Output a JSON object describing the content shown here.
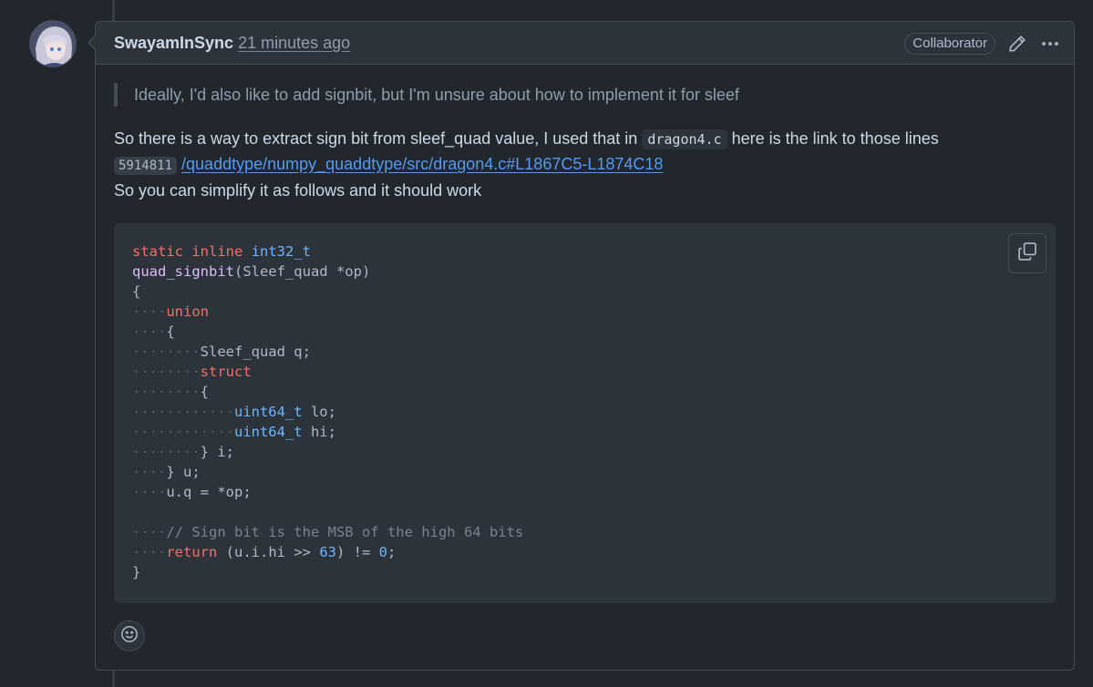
{
  "comment": {
    "author": "SwayamInSync",
    "timestamp": "21 minutes ago",
    "role_badge": "Collaborator",
    "quote": "Ideally, I'd also like to add signbit, but I'm unsure about how to implement it for sleef",
    "para1_before": "So there is a way to extract sign bit from sleef_quad value, I used that in ",
    "para1_code": "dragon4.c",
    "para1_after": " here is the link to those lines",
    "commit_sha": "5914811",
    "link_text": "/quaddtype/numpy_quaddtype/src/dragon4.c#L1867C5-L1874C18",
    "para2": "So you can simplify it as follows and it should work"
  },
  "code": {
    "l1_kw1": "static",
    "l1_kw2": "inline",
    "l1_type": "int32_t",
    "l2_fn": "quad_signbit",
    "l2_rest": "(Sleef_quad *op)",
    "l3": "{",
    "l4_kw": "union",
    "l5": "{",
    "l6": "Sleef_quad q;",
    "l7_kw": "struct",
    "l8": "{",
    "l9_type": "uint64_t",
    "l9_rest": " lo;",
    "l10_type": "uint64_t",
    "l10_rest": " hi;",
    "l11": "} i;",
    "l12": "} u;",
    "l13": "u.q = *op;",
    "l15_comment": "// Sign bit is the MSB of the high 64 bits",
    "l16_kw": "return",
    "l16_a": " (u.i.hi >> ",
    "l16_num1": "63",
    "l16_b": ") != ",
    "l16_num2": "0",
    "l16_c": ";",
    "l17": "}"
  },
  "icons": {
    "edit": "pencil-icon",
    "more": "kebab-horizontal-icon",
    "copy": "copy-icon",
    "reaction": "smiley-icon"
  },
  "colors": {
    "background": "#22272e",
    "header": "#2d333b",
    "border": "#444c56",
    "link": "#539bf5",
    "keyword": "#f47067",
    "type": "#6cb6ff",
    "function": "#dcbdfb"
  }
}
